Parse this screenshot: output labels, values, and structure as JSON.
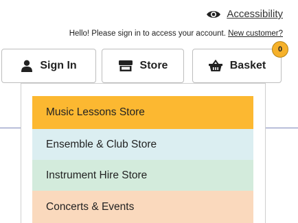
{
  "header": {
    "accessibility_label": "Accessibility",
    "greeting": "Hello! Please sign in to access your account.",
    "new_customer_link": "New customer?"
  },
  "buttons": {
    "sign_in": "Sign In",
    "store": "Store",
    "basket": "Basket",
    "basket_count": "0"
  },
  "store_menu": {
    "items": [
      {
        "label": "Music Lessons Store",
        "color": "#fcb831"
      },
      {
        "label": "Ensemble & Club Store",
        "color": "#dbeef1"
      },
      {
        "label": "Instrument Hire Store",
        "color": "#d3ebdc"
      },
      {
        "label": "Concerts & Events",
        "color": "#fad9bd"
      }
    ]
  },
  "icons": [
    "eye-icon",
    "user-icon",
    "store-icon",
    "basket-icon"
  ]
}
